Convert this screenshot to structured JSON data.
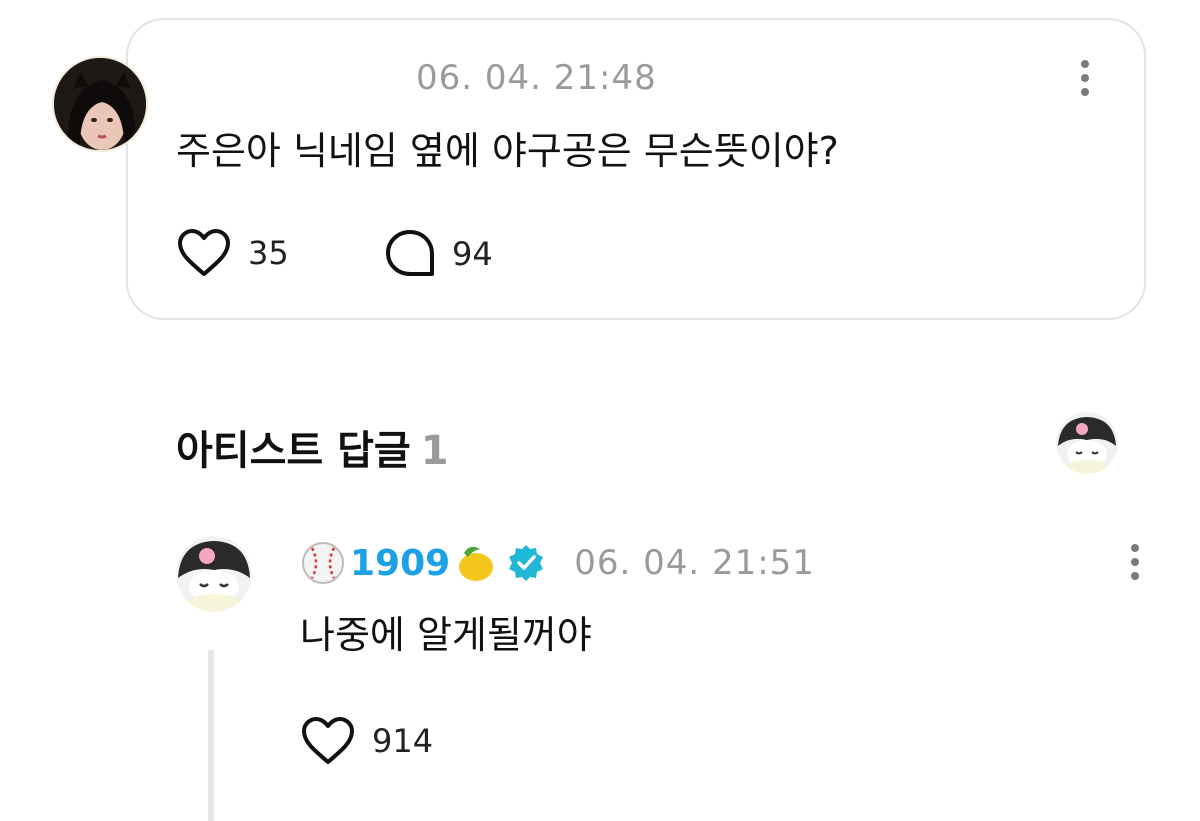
{
  "post": {
    "timestamp": "06. 04. 21:48",
    "text": "주은아 닉네임 옆에 야구공은 무슨뜻이야?",
    "like_count": "35",
    "comment_count": "94"
  },
  "artist_replies": {
    "title": "아티스트 답글",
    "count": "1"
  },
  "reply": {
    "username": "1909",
    "timestamp": "06. 04. 21:51",
    "text": "나중에 알게될꺼야",
    "like_count": "914"
  },
  "colors": {
    "username": "#1da1e6",
    "verified_badge": "#21b7d6",
    "muted_text": "#9a9a9a",
    "card_border": "#e3e3e3"
  },
  "icons": [
    "heart-icon",
    "comment-bubble-icon",
    "kebab-menu-icon",
    "baseball-icon",
    "lemon-icon",
    "verified-badge-icon"
  ]
}
